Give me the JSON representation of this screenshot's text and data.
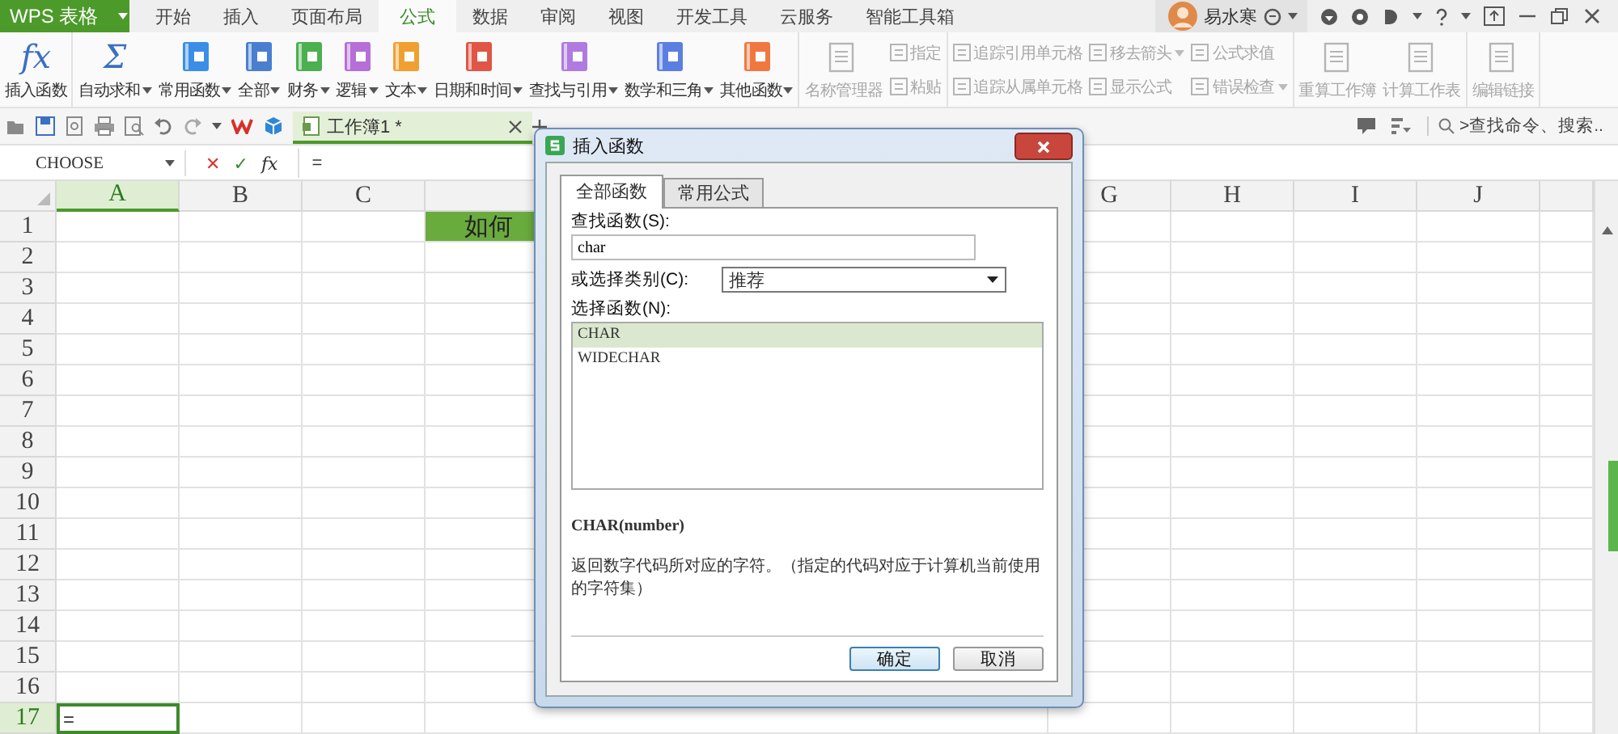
{
  "app_button": {
    "label": "WPS 表格"
  },
  "menu_tabs": [
    {
      "label": "开始",
      "selected": false
    },
    {
      "label": "插入",
      "selected": false
    },
    {
      "label": "页面布局",
      "selected": false
    },
    {
      "label": "公式",
      "selected": true
    },
    {
      "label": "数据",
      "selected": false
    },
    {
      "label": "审阅",
      "selected": false
    },
    {
      "label": "视图",
      "selected": false
    },
    {
      "label": "开发工具",
      "selected": false
    },
    {
      "label": "云服务",
      "selected": false
    },
    {
      "label": "智能工具箱",
      "selected": false
    }
  ],
  "account": {
    "name": "易水寒"
  },
  "ribbon_groups": [
    {
      "items": [
        {
          "kind": "symbol",
          "symbol": "fx",
          "label": "插入函数",
          "dropdown": false,
          "disabled": false
        }
      ]
    },
    {
      "items": [
        {
          "kind": "symbol",
          "symbol": "Σ",
          "label": "自动求和",
          "dropdown": true,
          "disabled": false
        },
        {
          "kind": "book",
          "color": "#3a8ee6",
          "label": "常用函数",
          "dropdown": true,
          "disabled": false
        },
        {
          "kind": "book",
          "color": "#4a7fd0",
          "label": "全部",
          "dropdown": true,
          "disabled": false
        },
        {
          "kind": "book",
          "color": "#4caf50",
          "label": "财务",
          "dropdown": true,
          "disabled": false
        },
        {
          "kind": "book",
          "color": "#b56fd6",
          "label": "逻辑",
          "dropdown": true,
          "disabled": false
        },
        {
          "kind": "book",
          "color": "#f0a030",
          "label": "文本",
          "dropdown": true,
          "disabled": false
        },
        {
          "kind": "book",
          "color": "#e05545",
          "label": "日期和时间",
          "dropdown": true,
          "disabled": false
        },
        {
          "kind": "book",
          "color": "#b07ae0",
          "label": "查找与引用",
          "dropdown": true,
          "disabled": false
        },
        {
          "kind": "book",
          "color": "#5b7fe0",
          "label": "数学和三角",
          "dropdown": true,
          "disabled": false
        },
        {
          "kind": "book",
          "color": "#f07840",
          "label": "其他函数",
          "dropdown": true,
          "disabled": false
        }
      ]
    },
    {
      "items": [
        {
          "kind": "large",
          "label": "名称管理器",
          "dropdown": false,
          "disabled": true
        },
        {
          "kind": "small",
          "label": "指定",
          "dropdown": false,
          "disabled": true
        },
        {
          "kind": "small",
          "label": "粘贴",
          "dropdown": false,
          "disabled": true
        }
      ]
    },
    {
      "items": [
        {
          "kind": "small",
          "label": "追踪引用单元格",
          "dropdown": false,
          "disabled": true
        },
        {
          "kind": "small",
          "label": "追踪从属单元格",
          "dropdown": false,
          "disabled": true
        },
        {
          "kind": "small",
          "label": "移去箭头",
          "dropdown": true,
          "disabled": true
        },
        {
          "kind": "small",
          "label": "显示公式",
          "dropdown": false,
          "disabled": true
        },
        {
          "kind": "small",
          "label": "公式求值",
          "dropdown": false,
          "disabled": true
        },
        {
          "kind": "small",
          "label": "错误检查",
          "dropdown": true,
          "disabled": true
        }
      ]
    },
    {
      "items": [
        {
          "kind": "large",
          "label": "重算工作簿",
          "dropdown": false,
          "disabled": true
        },
        {
          "kind": "large",
          "label": "计算工作表",
          "dropdown": false,
          "disabled": true
        }
      ]
    },
    {
      "items": [
        {
          "kind": "large",
          "label": "编辑链接",
          "dropdown": false,
          "disabled": true
        }
      ]
    }
  ],
  "document_tab": {
    "label": "工作簿1 *",
    "selected": true
  },
  "command_search": {
    "placeholder": ">查找命令、搜索..."
  },
  "formula_bar": {
    "name_box": "CHOOSE",
    "cancel": "✕",
    "enter": "✓",
    "fx": "fx",
    "formula": "="
  },
  "columns": [
    {
      "label": "A",
      "selected": true
    },
    {
      "label": "B",
      "selected": false
    },
    {
      "label": "C",
      "selected": false
    },
    {
      "label": "G",
      "selected": false
    },
    {
      "label": "H",
      "selected": false
    },
    {
      "label": "I",
      "selected": false
    },
    {
      "label": "J",
      "selected": false
    }
  ],
  "rows": [
    {
      "header": "1",
      "selected": false,
      "banner": "如何"
    },
    {
      "header": "2",
      "selected": false
    },
    {
      "header": "3",
      "selected": false
    },
    {
      "header": "4",
      "selected": false
    },
    {
      "header": "5",
      "selected": false
    },
    {
      "header": "6",
      "selected": false
    },
    {
      "header": "7",
      "selected": false
    },
    {
      "header": "8",
      "selected": false
    },
    {
      "header": "9",
      "selected": false
    },
    {
      "header": "10",
      "selected": false
    },
    {
      "header": "11",
      "selected": false
    },
    {
      "header": "12",
      "selected": false
    },
    {
      "header": "13",
      "selected": false
    },
    {
      "header": "14",
      "selected": false
    },
    {
      "header": "15",
      "selected": false
    },
    {
      "header": "16",
      "selected": false
    },
    {
      "header": "17",
      "selected": true,
      "active_cell": "="
    }
  ],
  "dialog": {
    "title": "插入函数",
    "tabs": [
      {
        "label": "全部函数",
        "selected": true
      },
      {
        "label": "常用公式",
        "selected": false
      }
    ],
    "search_label": "查找函数(S):",
    "search_value": "char",
    "category_label": "或选择类别(C):",
    "category_value": "推荐",
    "list_label": "选择函数(N):",
    "functions": [
      {
        "name": "CHAR",
        "selected": true
      },
      {
        "name": "WIDECHAR",
        "selected": false
      }
    ],
    "signature": "CHAR(number)",
    "description": "返回数字代码所对应的字符。（指定的代码对应于计算机当前使用的字符集）",
    "buttons": [
      "确定",
      "取消"
    ]
  }
}
